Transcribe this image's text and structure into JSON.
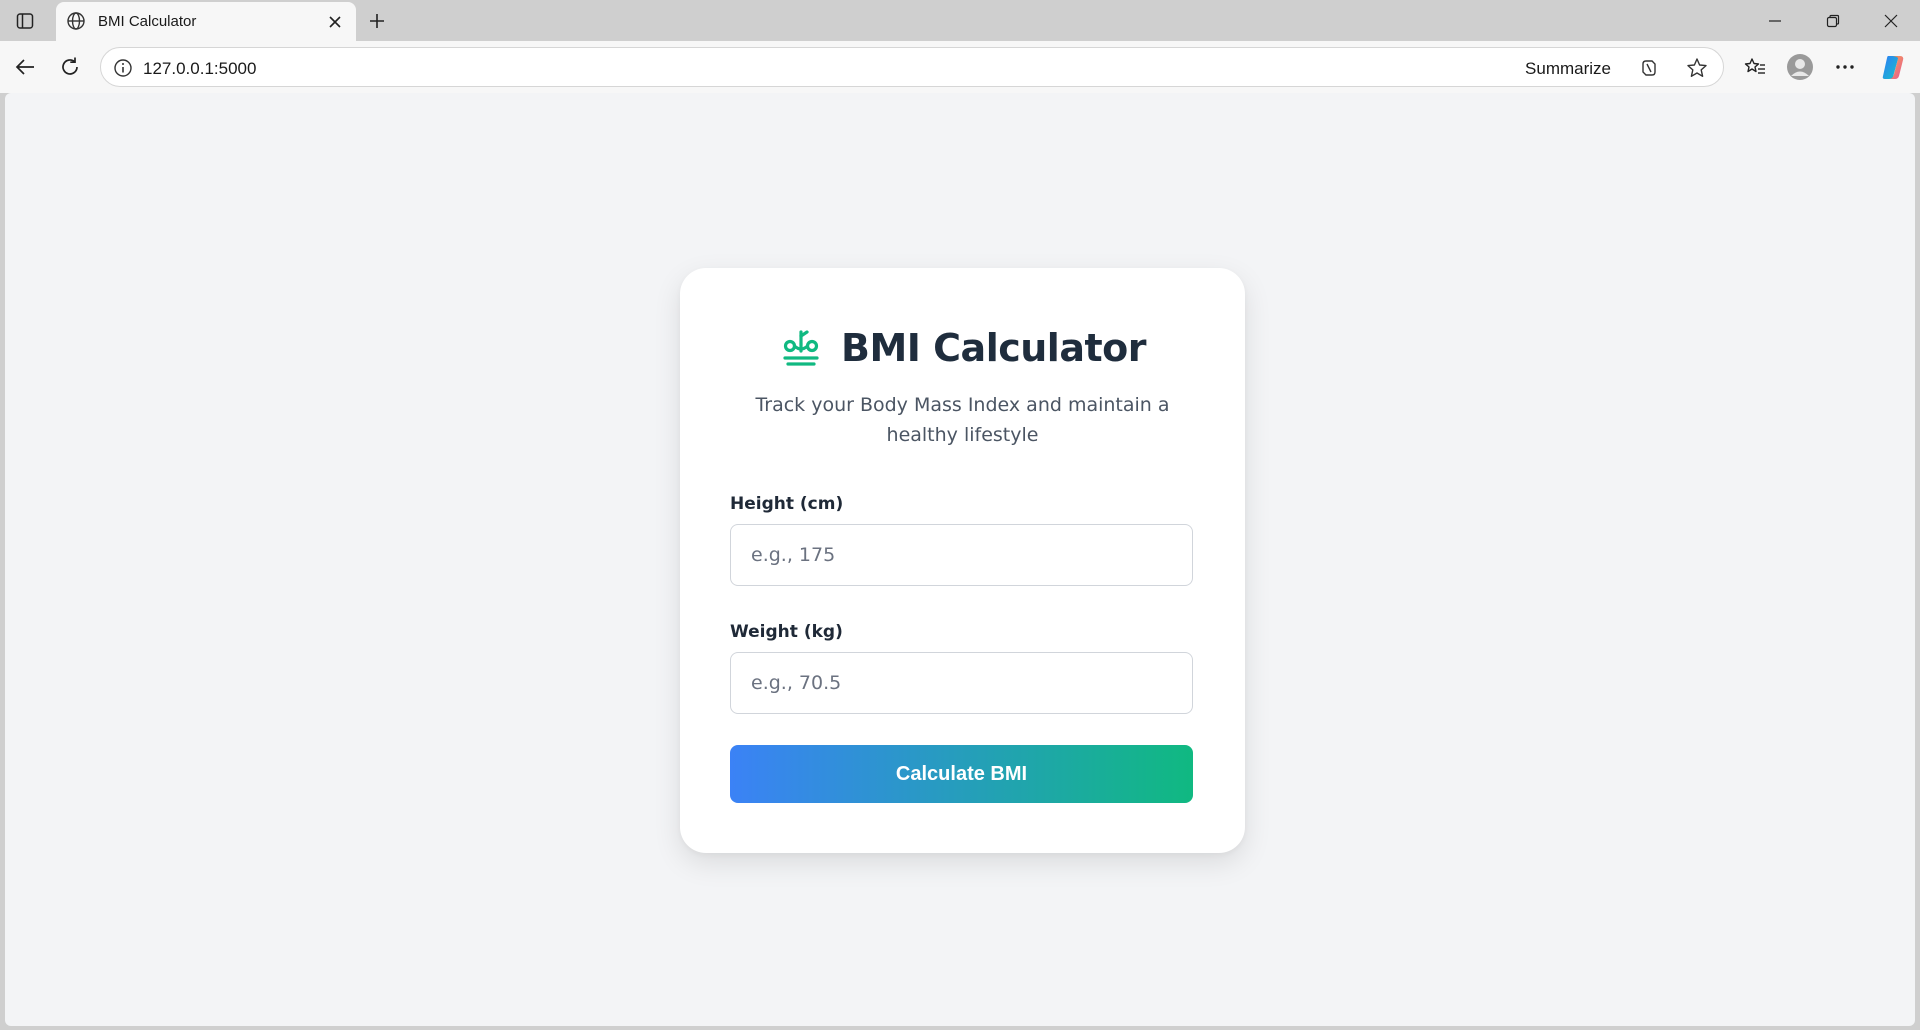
{
  "browser": {
    "tab_title": "BMI Calculator",
    "url": "127.0.0.1:5000",
    "summarize_label": "Summarize"
  },
  "page": {
    "title": "BMI Calculator",
    "subtitle": "Track your Body Mass Index and maintain a healthy lifestyle",
    "height_label": "Height (cm)",
    "height_placeholder": "e.g., 175",
    "weight_label": "Weight (kg)",
    "weight_placeholder": "e.g., 70.5",
    "calculate_label": "Calculate BMI"
  },
  "colors": {
    "brand_green": "#10b981",
    "gradient_start": "#3b82f6",
    "gradient_end": "#10b981",
    "heading": "#1f2d3d",
    "page_bg": "#f3f4f6"
  }
}
